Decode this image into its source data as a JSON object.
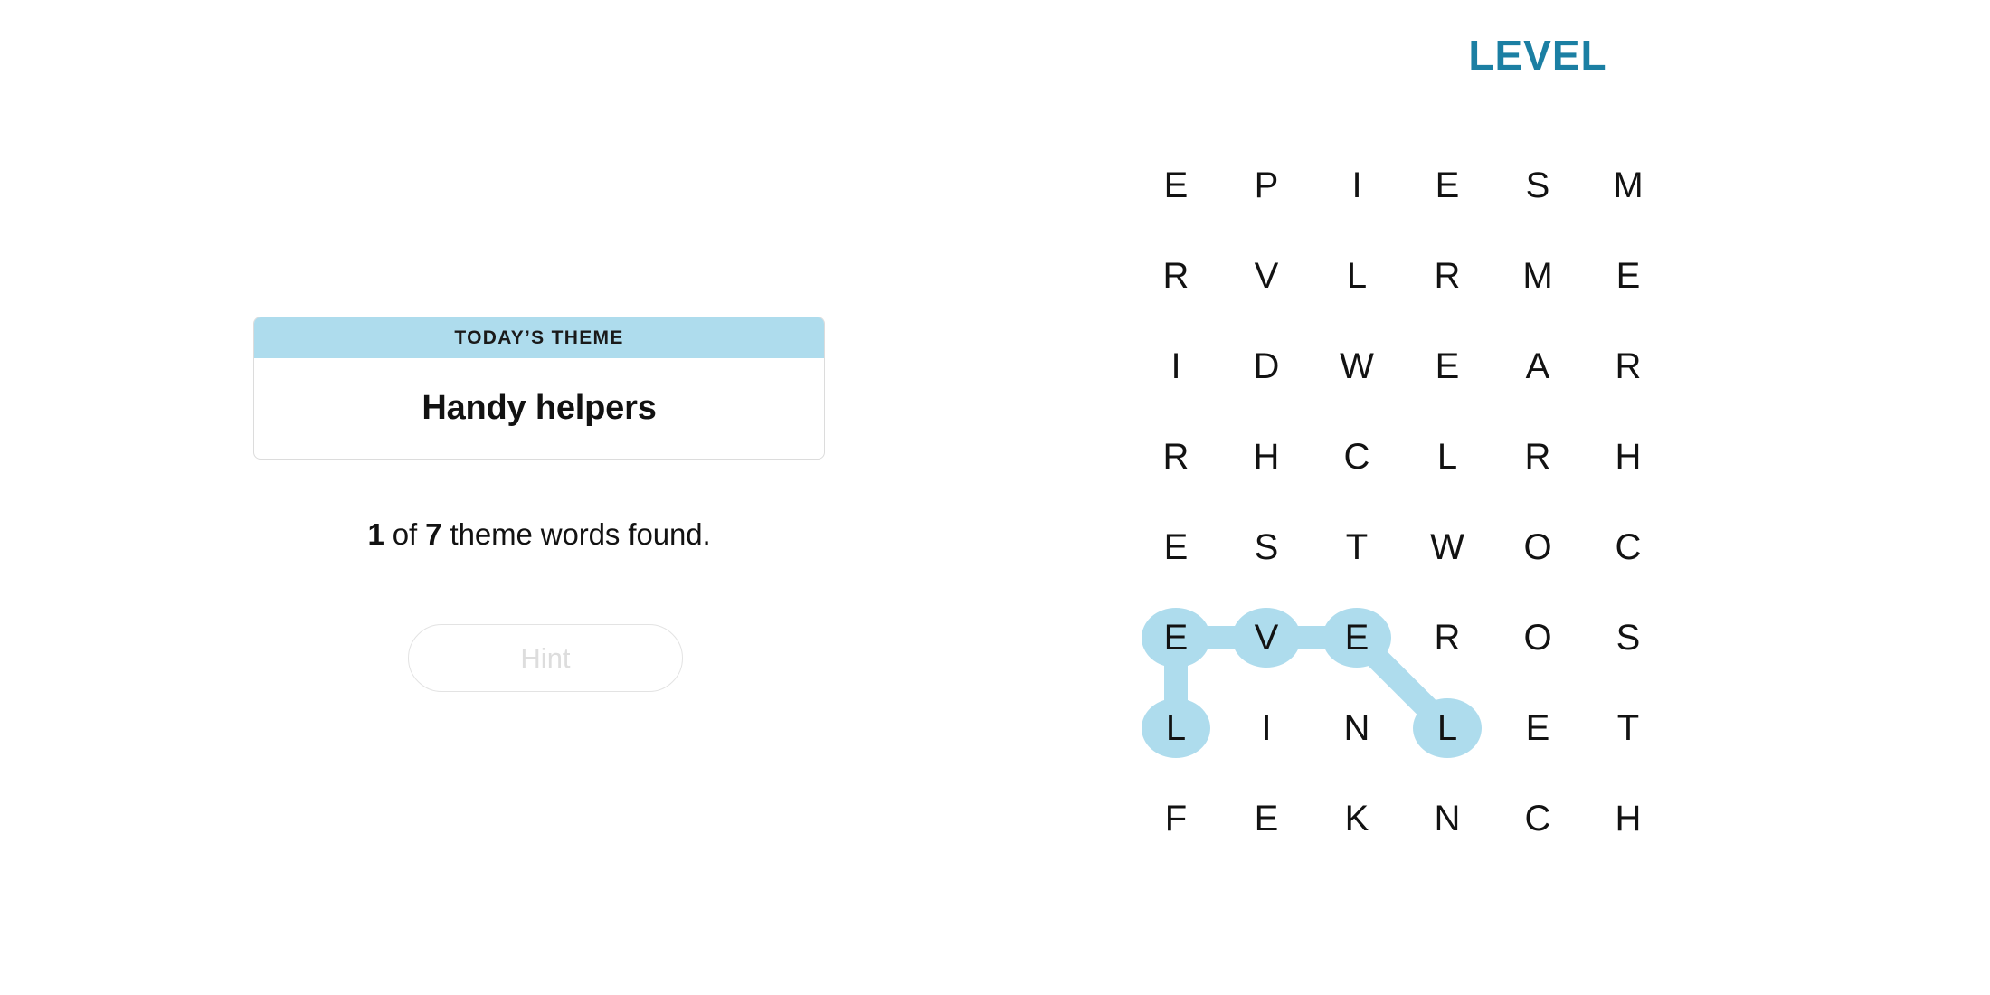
{
  "puzzle": {
    "title": "LEVEL",
    "title_color": "#1b7fa3",
    "highlight_color": "#aedced"
  },
  "theme_card": {
    "header_label": "TODAY’S THEME",
    "theme": "Handy helpers",
    "header_bg": "#aedced"
  },
  "progress": {
    "found": "1",
    "of_label": " of ",
    "total": "7",
    "suffix": " theme words found.",
    "full_text": "1 of 7 theme words found."
  },
  "hint": {
    "label": "Hint",
    "disabled": true
  },
  "grid": {
    "rows": 8,
    "cols": 6,
    "letters": [
      [
        "E",
        "P",
        "I",
        "E",
        "S",
        "M"
      ],
      [
        "R",
        "V",
        "L",
        "R",
        "M",
        "E"
      ],
      [
        "I",
        "D",
        "W",
        "E",
        "A",
        "R"
      ],
      [
        "R",
        "H",
        "C",
        "L",
        "R",
        "H"
      ],
      [
        "E",
        "S",
        "T",
        "W",
        "O",
        "C"
      ],
      [
        "E",
        "V",
        "E",
        "R",
        "O",
        "S"
      ],
      [
        "L",
        "I",
        "N",
        "L",
        "E",
        "T"
      ],
      [
        "F",
        "E",
        "K",
        "N",
        "C",
        "H"
      ]
    ],
    "highlighted_cells": [
      {
        "row": 5,
        "col": 0,
        "letter": "E"
      },
      {
        "row": 5,
        "col": 1,
        "letter": "V"
      },
      {
        "row": 5,
        "col": 2,
        "letter": "E"
      },
      {
        "row": 6,
        "col": 0,
        "letter": "L"
      },
      {
        "row": 6,
        "col": 3,
        "letter": "L"
      }
    ],
    "path_segments": [
      {
        "from": {
          "row": 5,
          "col": 0
        },
        "to": {
          "row": 5,
          "col": 1
        }
      },
      {
        "from": {
          "row": 5,
          "col": 1
        },
        "to": {
          "row": 5,
          "col": 2
        }
      },
      {
        "from": {
          "row": 5,
          "col": 2
        },
        "to": {
          "row": 6,
          "col": 3
        }
      },
      {
        "from": {
          "row": 5,
          "col": 0
        },
        "to": {
          "row": 6,
          "col": 0
        }
      }
    ]
  }
}
